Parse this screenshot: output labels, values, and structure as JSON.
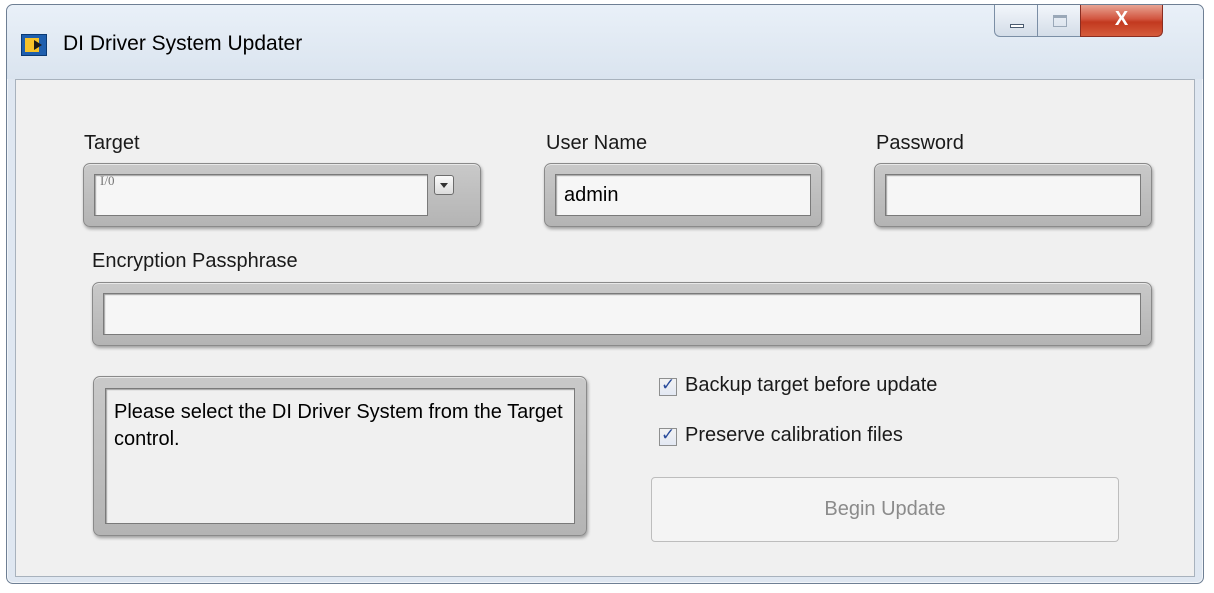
{
  "window": {
    "title": "DI Driver System Updater",
    "icon": "labview-app-icon",
    "close_label": "X"
  },
  "form": {
    "target": {
      "label": "Target",
      "value": "",
      "io_icon": "I/0"
    },
    "username": {
      "label": "User Name",
      "value": "admin"
    },
    "password": {
      "label": "Password",
      "value": ""
    },
    "passphrase": {
      "label": "Encryption Passphrase",
      "value": ""
    }
  },
  "status": {
    "message": "Please select the DI Driver System from the Target control."
  },
  "options": {
    "backup": {
      "label": "Backup target before update",
      "checked": true
    },
    "preserve": {
      "label": "Preserve calibration files",
      "checked": true
    }
  },
  "actions": {
    "begin_update_label": "Begin Update",
    "begin_update_enabled": false
  },
  "colors": {
    "frame_bg": "#dfe7f1",
    "panel_bg": "#f0f0f0",
    "close_red": "#c2391f",
    "check_blue": "#2a4c9b",
    "disabled_text": "#8b8b8b"
  }
}
